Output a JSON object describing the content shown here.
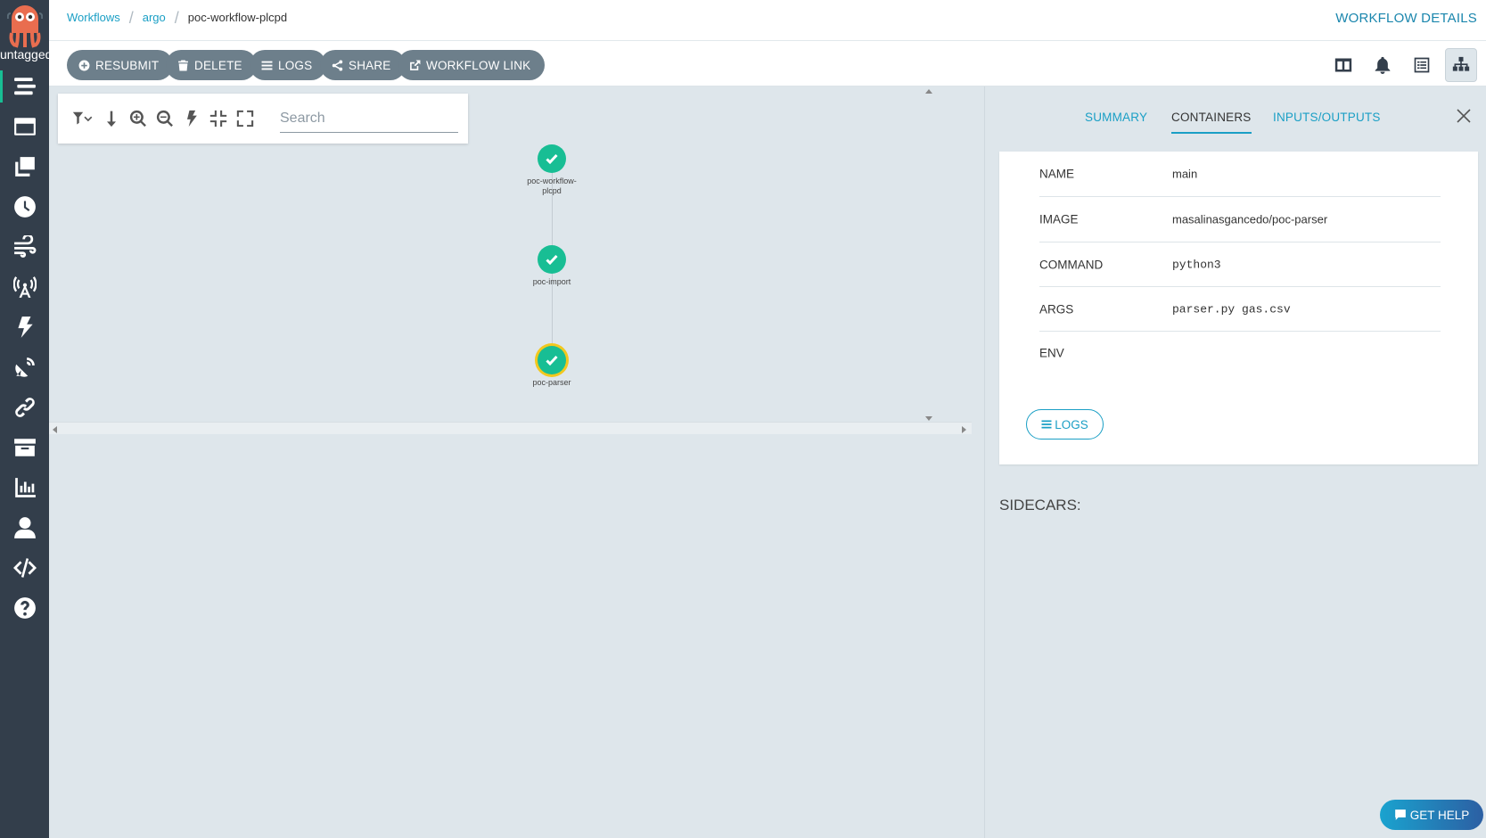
{
  "sidebar": {
    "version": "untagged",
    "items": [
      {
        "name": "workflows",
        "icon": "stream-icon"
      },
      {
        "name": "workflow-templates",
        "icon": "window-icon"
      },
      {
        "name": "cluster-workflow-templates",
        "icon": "clone-icon"
      },
      {
        "name": "cron-workflows",
        "icon": "clock-icon"
      },
      {
        "name": "event-flow",
        "icon": "wind-icon"
      },
      {
        "name": "event-sources",
        "icon": "broadcast-tower-icon"
      },
      {
        "name": "sensors",
        "icon": "bolt-icon"
      },
      {
        "name": "event-flow-2",
        "icon": "satellite-dish-icon"
      },
      {
        "name": "workflow-event-bindings",
        "icon": "link-icon"
      },
      {
        "name": "archived-workflows",
        "icon": "archive-icon"
      },
      {
        "name": "reports",
        "icon": "chart-bar-icon"
      },
      {
        "name": "user",
        "icon": "user-icon"
      },
      {
        "name": "api-docs",
        "icon": "code-icon"
      },
      {
        "name": "help",
        "icon": "question-circle-icon"
      }
    ]
  },
  "breadcrumbs": {
    "workflows": "Workflows",
    "namespace": "argo",
    "current": "poc-workflow-plcpd"
  },
  "page_title": "WORKFLOW DETAILS",
  "toolbar": {
    "resubmit": "RESUBMIT",
    "delete": "DELETE",
    "logs": "LOGS",
    "share": "SHARE",
    "workflow_link": "WORKFLOW LINK"
  },
  "graph": {
    "search_placeholder": "Search",
    "nodes": [
      {
        "label_line1": "poc-workflow-",
        "label_line2": "plcpd",
        "status": "succeeded"
      },
      {
        "label_line1": "poc-import",
        "label_line2": "",
        "status": "succeeded"
      },
      {
        "label_line1": "poc-parser",
        "label_line2": "",
        "status": "succeeded",
        "selected": true
      }
    ]
  },
  "panel": {
    "tabs": {
      "summary": "SUMMARY",
      "containers": "CONTAINERS",
      "inputs_outputs": "INPUTS/OUTPUTS"
    },
    "container": {
      "name_label": "NAME",
      "name_value": "main",
      "image_label": "IMAGE",
      "image_value": "masalinasgancedo/poc-parser",
      "command_label": "COMMAND",
      "command_value": "python3",
      "args_label": "ARGS",
      "args_value": "parser.py gas.csv",
      "env_label": "ENV",
      "env_value": ""
    },
    "logs_button": "LOGS",
    "sidecars": "SIDECARS:"
  },
  "get_help": "GET HELP",
  "colors": {
    "sidebar": "#333e4b",
    "accent": "#1a9fc5",
    "success": "#18be94",
    "selected_ring": "#f2c81e",
    "button_gray": "#6d7f8b"
  }
}
